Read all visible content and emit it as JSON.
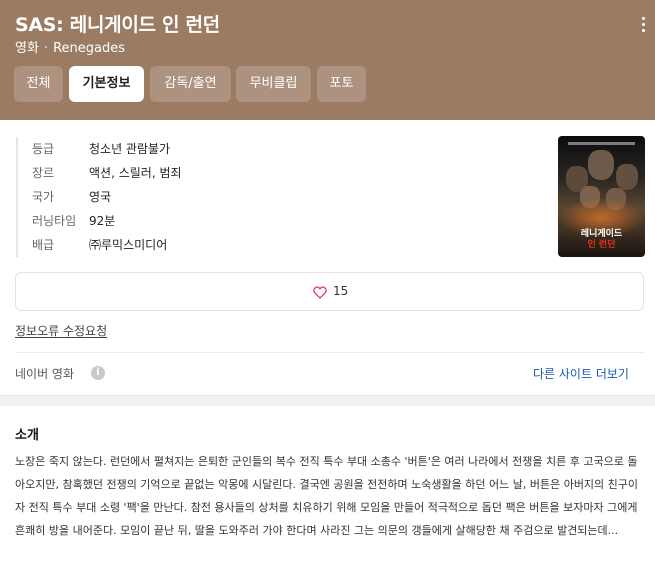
{
  "header": {
    "title": "SAS: 레니게이드 인 런던",
    "category": "영화",
    "original_title": "Renegades",
    "background_color": "#9b7c63"
  },
  "tabs": [
    {
      "label": "전체",
      "active": false
    },
    {
      "label": "기본정보",
      "active": true
    },
    {
      "label": "감독/출연",
      "active": false
    },
    {
      "label": "무비클립",
      "active": false
    },
    {
      "label": "포토",
      "active": false
    }
  ],
  "info": [
    {
      "label": "등급",
      "value": "청소년 관람불가"
    },
    {
      "label": "장르",
      "value": "액션, 스릴러, 범죄"
    },
    {
      "label": "국가",
      "value": "영국"
    },
    {
      "label": "러닝타임",
      "value": "92분"
    },
    {
      "label": "배급",
      "value": "㈜루믹스미디어"
    }
  ],
  "poster": {
    "title_line1": "레니게이드",
    "title_line2": "인 런던",
    "title_line2_color": "#e0331f"
  },
  "likes": {
    "icon": "heart-outline-icon",
    "count": "15",
    "heart_color": "#e0335a"
  },
  "report_link": "정보오류 수정요청",
  "source": {
    "label": "네이버 영화",
    "info_icon": "info-icon",
    "more_link": "다른 사이트 더보기",
    "link_color": "#1d5aa8"
  },
  "synopsis": {
    "title": "소개",
    "text": "노장은 죽지 않는다. 런던에서 펼쳐지는 은퇴한 군인들의 복수 전직 특수 부대 소총수 '버튼'은 여러 나라에서 전쟁을 치른 후 고국으로 돌아오지만, 참혹했던 전쟁의 기억으로 끝없는 악몽에 시달린다. 결국엔 공원을 전전하며 노숙생활을 하던 어느 날, 버튼은 아버지의 친구이자 전직 특수 부대 소령 '팩'을 만난다. 참전 용사들의 상처를 치유하기 위해 모임을 만들어 적극적으로 돕던 팩은 버튼을 보자마자 그에게 흔쾌히 방을 내어준다. 모임이 끝난 뒤, 딸을 도와주러 가야 한다며 사라진 그는 의문의 갱들에게 살해당한 채 주검으로 발견되는데..."
  }
}
